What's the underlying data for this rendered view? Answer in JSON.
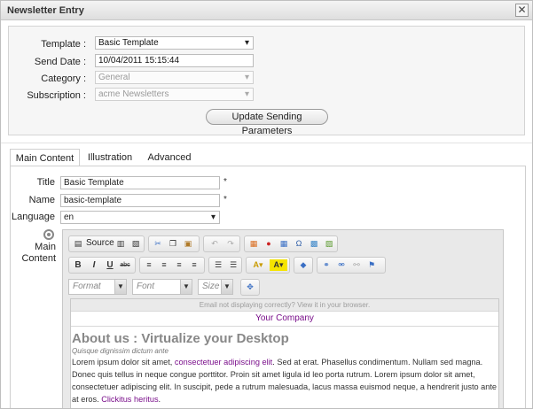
{
  "window": {
    "title": "Newsletter Entry",
    "close_glyph": "✕"
  },
  "params": {
    "template_label": "Template :",
    "template_value": "Basic Template",
    "send_date_label": "Send Date :",
    "send_date_value": "10/04/2011 15:15:44",
    "category_label": "Category :",
    "category_value": "General",
    "subscription_label": "Subscription :",
    "subscription_value": "acme Newsletters",
    "update_button": "Update Sending Parameters"
  },
  "tabs": [
    "Main Content",
    "Illustration",
    "Advanced"
  ],
  "form": {
    "title_label": "Title",
    "title_value": "Basic Template",
    "name_label": "Name",
    "name_value": "basic-template",
    "language_label": "Language",
    "language_value": "en",
    "main_content_label_1": "Main",
    "main_content_label_2": "Content",
    "required_marker": "*"
  },
  "editor": {
    "source_label": "Source",
    "bold": "B",
    "italic": "I",
    "underline": "U",
    "strike": "abc",
    "format_placeholder": "Format",
    "font_placeholder": "Font",
    "size_placeholder": "Size"
  },
  "content": {
    "email_note": "Email not displaying correctly? View it in your browser.",
    "company": "Your Company",
    "heading": "About us : Virtualize your Desktop",
    "subtitle": "Quisque dignissim dictum ante",
    "para_1": "Lorem ipsum dolor sit amet, ",
    "para_link_1": "consectetuer adipiscing elit",
    "para_2": ". Sed at erat. Phasellus condimentum. Nullam sed magna. Donec quis tellus in neque congue porttitor. Proin sit amet ligula id leo porta rutrum. Lorem ipsum dolor sit amet, consectetuer adipiscing elit. In suscipit, pede a rutrum malesuada, lacus massa euismod neque, a hendrerit justo ante at eros. ",
    "para_link_2": "Clickitus heritus",
    "para_3": "."
  },
  "colors": {
    "link": "#7a0f8b",
    "panel_bg": "#f6f6f6"
  }
}
